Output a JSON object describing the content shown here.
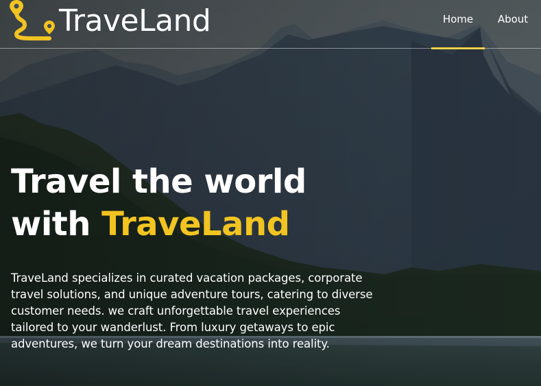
{
  "brand": {
    "name": "TraveLand",
    "accent_color": "#f2c422",
    "logo_icon": "route-map-pin-icon"
  },
  "nav": {
    "items": [
      {
        "label": "Home",
        "active": true
      },
      {
        "label": "About",
        "active": false
      }
    ]
  },
  "hero": {
    "title_line1": "Travel the world",
    "title_line2_prefix": "with ",
    "title_line2_accent": "TraveLand",
    "description": "TraveLand specializes in curated vacation packages, corporate travel solutions, and unique adventure tours, catering to diverse customer needs. we craft unforgettable travel experiences tailored to your wanderlust. From luxury getaways to epic adventures, we turn your dream destinations into reality.",
    "background_image": "mountain-lake-forest-photo"
  }
}
